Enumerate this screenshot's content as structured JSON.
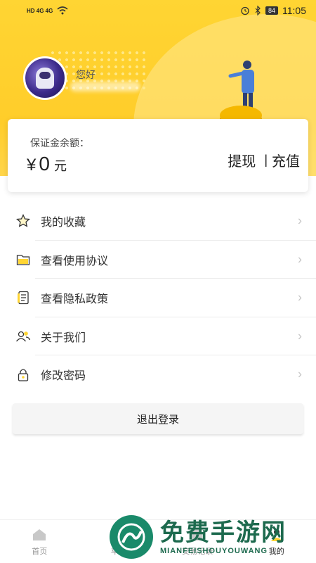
{
  "status_bar": {
    "left_text": "HD 4G 4G",
    "battery": "84",
    "time": "11:05"
  },
  "profile": {
    "greeting": "您好"
  },
  "balance_card": {
    "label": "保证金余额：",
    "currency": "¥",
    "value": "0",
    "unit": "元",
    "withdraw": "提现",
    "separator": "|",
    "recharge": "充值"
  },
  "menu": {
    "items": [
      {
        "label": "我的收藏",
        "icon": "star-icon"
      },
      {
        "label": "查看使用协议",
        "icon": "folder-icon"
      },
      {
        "label": "查看隐私政策",
        "icon": "document-icon"
      },
      {
        "label": "关于我们",
        "icon": "people-icon"
      },
      {
        "label": "修改密码",
        "icon": "lock-icon"
      }
    ]
  },
  "logout": {
    "label": "退出登录"
  },
  "tabbar": {
    "tabs": [
      {
        "label": "首页",
        "icon": "home-icon"
      },
      {
        "label": "车辆",
        "icon": "car-icon"
      },
      {
        "label": "交易记录",
        "icon": "record-icon"
      },
      {
        "label": "我的",
        "icon": "user-icon"
      }
    ]
  },
  "watermark": {
    "title": "免费手游网",
    "subtitle": "MIANFEISHOUYOUWANG"
  },
  "colors": {
    "header_yellow": "#ffd533",
    "coin": "#f5b800",
    "watermark_green": "#1d6a4e"
  }
}
